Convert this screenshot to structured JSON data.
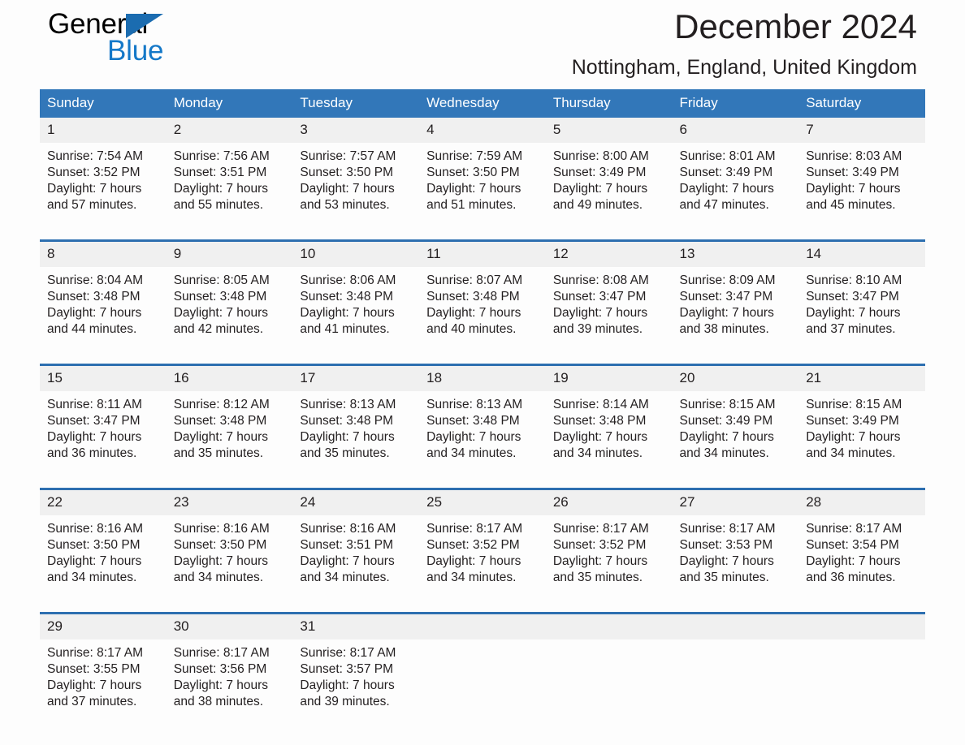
{
  "brand": {
    "name_part1": "General",
    "name_part2": "Blue",
    "color_black": "#000000",
    "color_blue": "#1478c8"
  },
  "header": {
    "title": "December 2024",
    "subtitle": "Nottingham, England, United Kingdom"
  },
  "theme": {
    "header_bar": "#3277b9",
    "row_divider": "#2d6fb0",
    "daynum_bg": "#f0f0f0",
    "page_bg": "#fdfdfd",
    "text": "#231f20"
  },
  "columns": [
    "Sunday",
    "Monday",
    "Tuesday",
    "Wednesday",
    "Thursday",
    "Friday",
    "Saturday"
  ],
  "weeks": [
    {
      "days": [
        {
          "num": "1",
          "sunrise": "Sunrise: 7:54 AM",
          "sunset": "Sunset: 3:52 PM",
          "daylight1": "Daylight: 7 hours",
          "daylight2": "and 57 minutes."
        },
        {
          "num": "2",
          "sunrise": "Sunrise: 7:56 AM",
          "sunset": "Sunset: 3:51 PM",
          "daylight1": "Daylight: 7 hours",
          "daylight2": "and 55 minutes."
        },
        {
          "num": "3",
          "sunrise": "Sunrise: 7:57 AM",
          "sunset": "Sunset: 3:50 PM",
          "daylight1": "Daylight: 7 hours",
          "daylight2": "and 53 minutes."
        },
        {
          "num": "4",
          "sunrise": "Sunrise: 7:59 AM",
          "sunset": "Sunset: 3:50 PM",
          "daylight1": "Daylight: 7 hours",
          "daylight2": "and 51 minutes."
        },
        {
          "num": "5",
          "sunrise": "Sunrise: 8:00 AM",
          "sunset": "Sunset: 3:49 PM",
          "daylight1": "Daylight: 7 hours",
          "daylight2": "and 49 minutes."
        },
        {
          "num": "6",
          "sunrise": "Sunrise: 8:01 AM",
          "sunset": "Sunset: 3:49 PM",
          "daylight1": "Daylight: 7 hours",
          "daylight2": "and 47 minutes."
        },
        {
          "num": "7",
          "sunrise": "Sunrise: 8:03 AM",
          "sunset": "Sunset: 3:49 PM",
          "daylight1": "Daylight: 7 hours",
          "daylight2": "and 45 minutes."
        }
      ]
    },
    {
      "days": [
        {
          "num": "8",
          "sunrise": "Sunrise: 8:04 AM",
          "sunset": "Sunset: 3:48 PM",
          "daylight1": "Daylight: 7 hours",
          "daylight2": "and 44 minutes."
        },
        {
          "num": "9",
          "sunrise": "Sunrise: 8:05 AM",
          "sunset": "Sunset: 3:48 PM",
          "daylight1": "Daylight: 7 hours",
          "daylight2": "and 42 minutes."
        },
        {
          "num": "10",
          "sunrise": "Sunrise: 8:06 AM",
          "sunset": "Sunset: 3:48 PM",
          "daylight1": "Daylight: 7 hours",
          "daylight2": "and 41 minutes."
        },
        {
          "num": "11",
          "sunrise": "Sunrise: 8:07 AM",
          "sunset": "Sunset: 3:48 PM",
          "daylight1": "Daylight: 7 hours",
          "daylight2": "and 40 minutes."
        },
        {
          "num": "12",
          "sunrise": "Sunrise: 8:08 AM",
          "sunset": "Sunset: 3:47 PM",
          "daylight1": "Daylight: 7 hours",
          "daylight2": "and 39 minutes."
        },
        {
          "num": "13",
          "sunrise": "Sunrise: 8:09 AM",
          "sunset": "Sunset: 3:47 PM",
          "daylight1": "Daylight: 7 hours",
          "daylight2": "and 38 minutes."
        },
        {
          "num": "14",
          "sunrise": "Sunrise: 8:10 AM",
          "sunset": "Sunset: 3:47 PM",
          "daylight1": "Daylight: 7 hours",
          "daylight2": "and 37 minutes."
        }
      ]
    },
    {
      "days": [
        {
          "num": "15",
          "sunrise": "Sunrise: 8:11 AM",
          "sunset": "Sunset: 3:47 PM",
          "daylight1": "Daylight: 7 hours",
          "daylight2": "and 36 minutes."
        },
        {
          "num": "16",
          "sunrise": "Sunrise: 8:12 AM",
          "sunset": "Sunset: 3:48 PM",
          "daylight1": "Daylight: 7 hours",
          "daylight2": "and 35 minutes."
        },
        {
          "num": "17",
          "sunrise": "Sunrise: 8:13 AM",
          "sunset": "Sunset: 3:48 PM",
          "daylight1": "Daylight: 7 hours",
          "daylight2": "and 35 minutes."
        },
        {
          "num": "18",
          "sunrise": "Sunrise: 8:13 AM",
          "sunset": "Sunset: 3:48 PM",
          "daylight1": "Daylight: 7 hours",
          "daylight2": "and 34 minutes."
        },
        {
          "num": "19",
          "sunrise": "Sunrise: 8:14 AM",
          "sunset": "Sunset: 3:48 PM",
          "daylight1": "Daylight: 7 hours",
          "daylight2": "and 34 minutes."
        },
        {
          "num": "20",
          "sunrise": "Sunrise: 8:15 AM",
          "sunset": "Sunset: 3:49 PM",
          "daylight1": "Daylight: 7 hours",
          "daylight2": "and 34 minutes."
        },
        {
          "num": "21",
          "sunrise": "Sunrise: 8:15 AM",
          "sunset": "Sunset: 3:49 PM",
          "daylight1": "Daylight: 7 hours",
          "daylight2": "and 34 minutes."
        }
      ]
    },
    {
      "days": [
        {
          "num": "22",
          "sunrise": "Sunrise: 8:16 AM",
          "sunset": "Sunset: 3:50 PM",
          "daylight1": "Daylight: 7 hours",
          "daylight2": "and 34 minutes."
        },
        {
          "num": "23",
          "sunrise": "Sunrise: 8:16 AM",
          "sunset": "Sunset: 3:50 PM",
          "daylight1": "Daylight: 7 hours",
          "daylight2": "and 34 minutes."
        },
        {
          "num": "24",
          "sunrise": "Sunrise: 8:16 AM",
          "sunset": "Sunset: 3:51 PM",
          "daylight1": "Daylight: 7 hours",
          "daylight2": "and 34 minutes."
        },
        {
          "num": "25",
          "sunrise": "Sunrise: 8:17 AM",
          "sunset": "Sunset: 3:52 PM",
          "daylight1": "Daylight: 7 hours",
          "daylight2": "and 34 minutes."
        },
        {
          "num": "26",
          "sunrise": "Sunrise: 8:17 AM",
          "sunset": "Sunset: 3:52 PM",
          "daylight1": "Daylight: 7 hours",
          "daylight2": "and 35 minutes."
        },
        {
          "num": "27",
          "sunrise": "Sunrise: 8:17 AM",
          "sunset": "Sunset: 3:53 PM",
          "daylight1": "Daylight: 7 hours",
          "daylight2": "and 35 minutes."
        },
        {
          "num": "28",
          "sunrise": "Sunrise: 8:17 AM",
          "sunset": "Sunset: 3:54 PM",
          "daylight1": "Daylight: 7 hours",
          "daylight2": "and 36 minutes."
        }
      ]
    },
    {
      "days": [
        {
          "num": "29",
          "sunrise": "Sunrise: 8:17 AM",
          "sunset": "Sunset: 3:55 PM",
          "daylight1": "Daylight: 7 hours",
          "daylight2": "and 37 minutes."
        },
        {
          "num": "30",
          "sunrise": "Sunrise: 8:17 AM",
          "sunset": "Sunset: 3:56 PM",
          "daylight1": "Daylight: 7 hours",
          "daylight2": "and 38 minutes."
        },
        {
          "num": "31",
          "sunrise": "Sunrise: 8:17 AM",
          "sunset": "Sunset: 3:57 PM",
          "daylight1": "Daylight: 7 hours",
          "daylight2": "and 39 minutes."
        },
        {
          "num": "",
          "sunrise": "",
          "sunset": "",
          "daylight1": "",
          "daylight2": ""
        },
        {
          "num": "",
          "sunrise": "",
          "sunset": "",
          "daylight1": "",
          "daylight2": ""
        },
        {
          "num": "",
          "sunrise": "",
          "sunset": "",
          "daylight1": "",
          "daylight2": ""
        },
        {
          "num": "",
          "sunrise": "",
          "sunset": "",
          "daylight1": "",
          "daylight2": ""
        }
      ]
    }
  ]
}
